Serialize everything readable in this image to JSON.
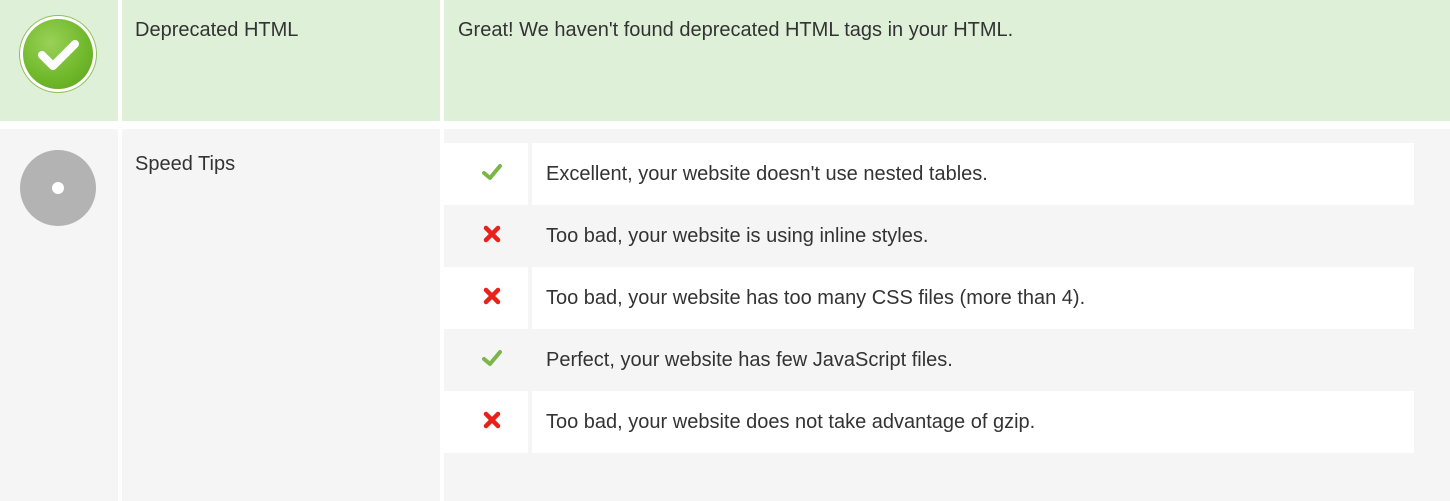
{
  "rows": {
    "deprecated": {
      "label": "Deprecated HTML",
      "status": "success",
      "message": "Great! We haven't found deprecated HTML tags in your HTML."
    },
    "speed": {
      "label": "Speed Tips",
      "status": "neutral",
      "tips": [
        {
          "status": "pass",
          "icon": "check-icon",
          "text": "Excellent, your website doesn't use nested tables."
        },
        {
          "status": "fail",
          "icon": "cross-icon",
          "text": "Too bad, your website is using inline styles."
        },
        {
          "status": "fail",
          "icon": "cross-icon",
          "text": "Too bad, your website has too many CSS files (more than 4)."
        },
        {
          "status": "pass",
          "icon": "check-icon",
          "text": "Perfect, your website has few JavaScript files."
        },
        {
          "status": "fail",
          "icon": "cross-icon",
          "text": "Too bad, your website does not take advantage of gzip."
        }
      ]
    }
  },
  "colors": {
    "success_bg": "#dff0d8",
    "neutral_bg": "#f5f5f5",
    "pass": "#7ab648",
    "fail": "#e8221b"
  }
}
